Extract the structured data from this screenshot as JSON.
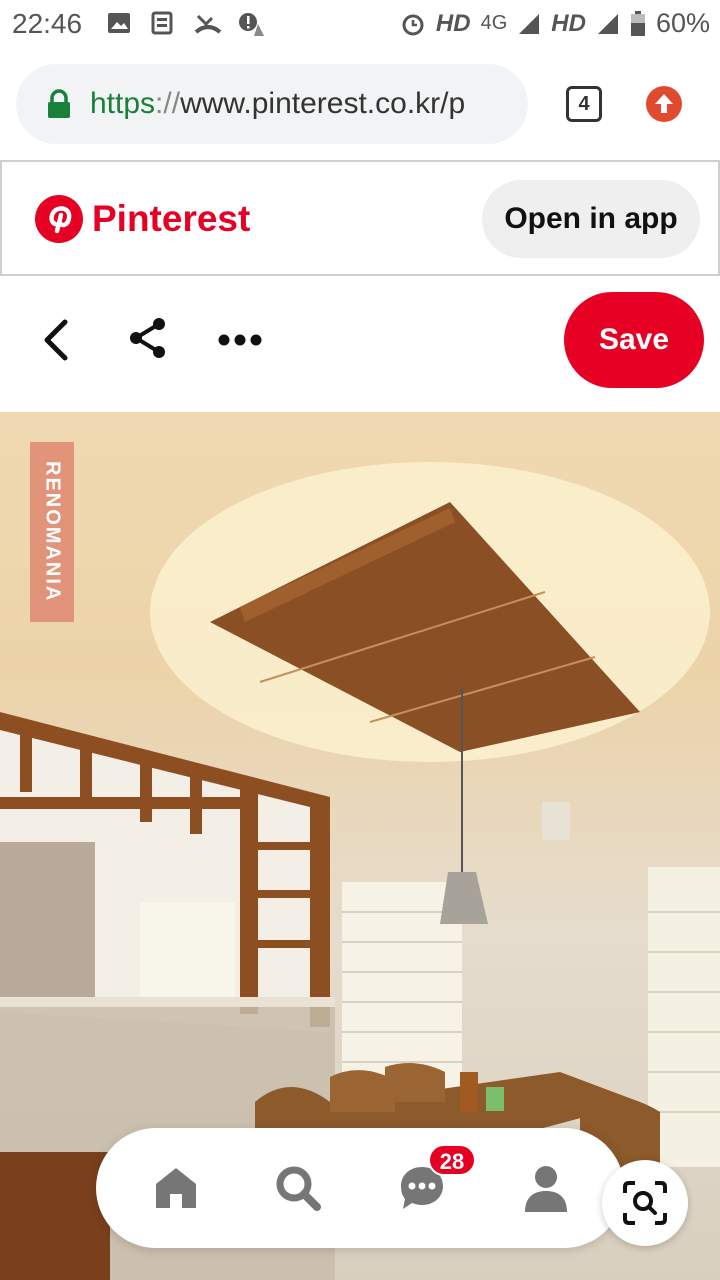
{
  "status_bar": {
    "time": "22:46",
    "network_hd1": "HD",
    "network_4g": "4G",
    "network_hd2": "HD",
    "battery": "60%",
    "icons": [
      "image-icon",
      "news-icon",
      "missed-call-icon",
      "alert-icon",
      "alarm-icon",
      "signal-icon",
      "battery-icon"
    ]
  },
  "browser": {
    "url_scheme": "https",
    "url_sep": "://",
    "url_rest": "www.pinterest.co.kr/p",
    "tab_count": "4"
  },
  "banner": {
    "brand_name": "Pinterest",
    "open_in_app": "Open in app"
  },
  "actions": {
    "save_label": "Save"
  },
  "pin": {
    "watermark": "RENOMANIA"
  },
  "bottom_nav": {
    "message_badge": "28"
  },
  "colors": {
    "brand_red": "#e60023",
    "url_green": "#188038",
    "upload_red": "#e04a2f"
  }
}
